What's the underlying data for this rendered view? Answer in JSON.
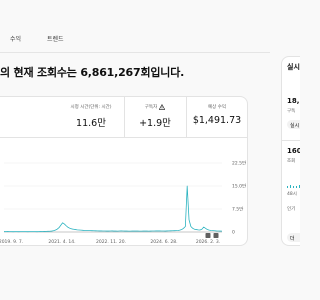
{
  "tabs": [
    {
      "label": "수익"
    },
    {
      "label": "트렌드"
    }
  ],
  "headline": "의 현재 조회수는 6,861,267회입니다.",
  "metrics": [
    {
      "label": "시청 시간(단위: 시간)",
      "value": "11.6만"
    },
    {
      "label": "구독자",
      "value": "+1.9만",
      "icon": "warning-icon"
    },
    {
      "label": "예상 수익",
      "value": "$1,491.73"
    }
  ],
  "chart_data": {
    "type": "line",
    "x_labels": [
      "2019. 9. 7.",
      "2021. 4. 14.",
      "2022. 11. 20.",
      "2024. 6. 28.",
      "2026. 2. 3."
    ],
    "y_labels": [
      "22.5만",
      "15.0만",
      "7.5만",
      "0"
    ],
    "ylim": [
      0,
      225000
    ],
    "series": [
      {
        "color": "#2bb3c0",
        "values": [
          1500,
          1200,
          1400,
          1100,
          1300,
          1000,
          1200,
          1100,
          1000,
          1200,
          1100,
          1300,
          1200,
          1000,
          1100,
          1200,
          1300,
          1100,
          1000,
          1200,
          1400,
          1600,
          1800,
          2000,
          2200,
          2500,
          3000,
          4000,
          6000,
          9000,
          14000,
          22000,
          30000,
          26000,
          20000,
          15000,
          12000,
          10000,
          9000,
          8000,
          7000,
          6500,
          6000,
          5500,
          5000,
          4800,
          4600,
          4400,
          4200,
          4000,
          3800,
          3600,
          3500,
          3400,
          3300,
          3200,
          3100,
          3000,
          3200,
          3400,
          3100,
          3000,
          2900,
          3200,
          3500,
          3300,
          3100,
          3000,
          2900,
          2800,
          3000,
          3200,
          3100,
          3000,
          2900,
          2800,
          3000,
          3100,
          3000,
          2900,
          3100,
          3300,
          3200,
          3400,
          3600,
          3500,
          3300,
          3200,
          3100,
          3400,
          3600,
          3800,
          4000,
          4200,
          4500,
          5000,
          6000,
          8000,
          12000,
          18000,
          150000,
          40000,
          18000,
          12000,
          9000,
          8000,
          7000,
          6500,
          9000,
          16000,
          12000,
          8000,
          6000,
          5000,
          4500,
          4000,
          3500,
          3200,
          3000,
          2800
        ]
      }
    ]
  },
  "side": {
    "title": "실시",
    "num1": "18,",
    "sub1": "구독",
    "chip": "실시",
    "num2": "160",
    "sub2": "조회",
    "sub3": "48시",
    "sub4": "인기",
    "bottom": "더"
  },
  "colors": {
    "accent": "#2bb3c0",
    "anomaly_marker": "#606060"
  }
}
